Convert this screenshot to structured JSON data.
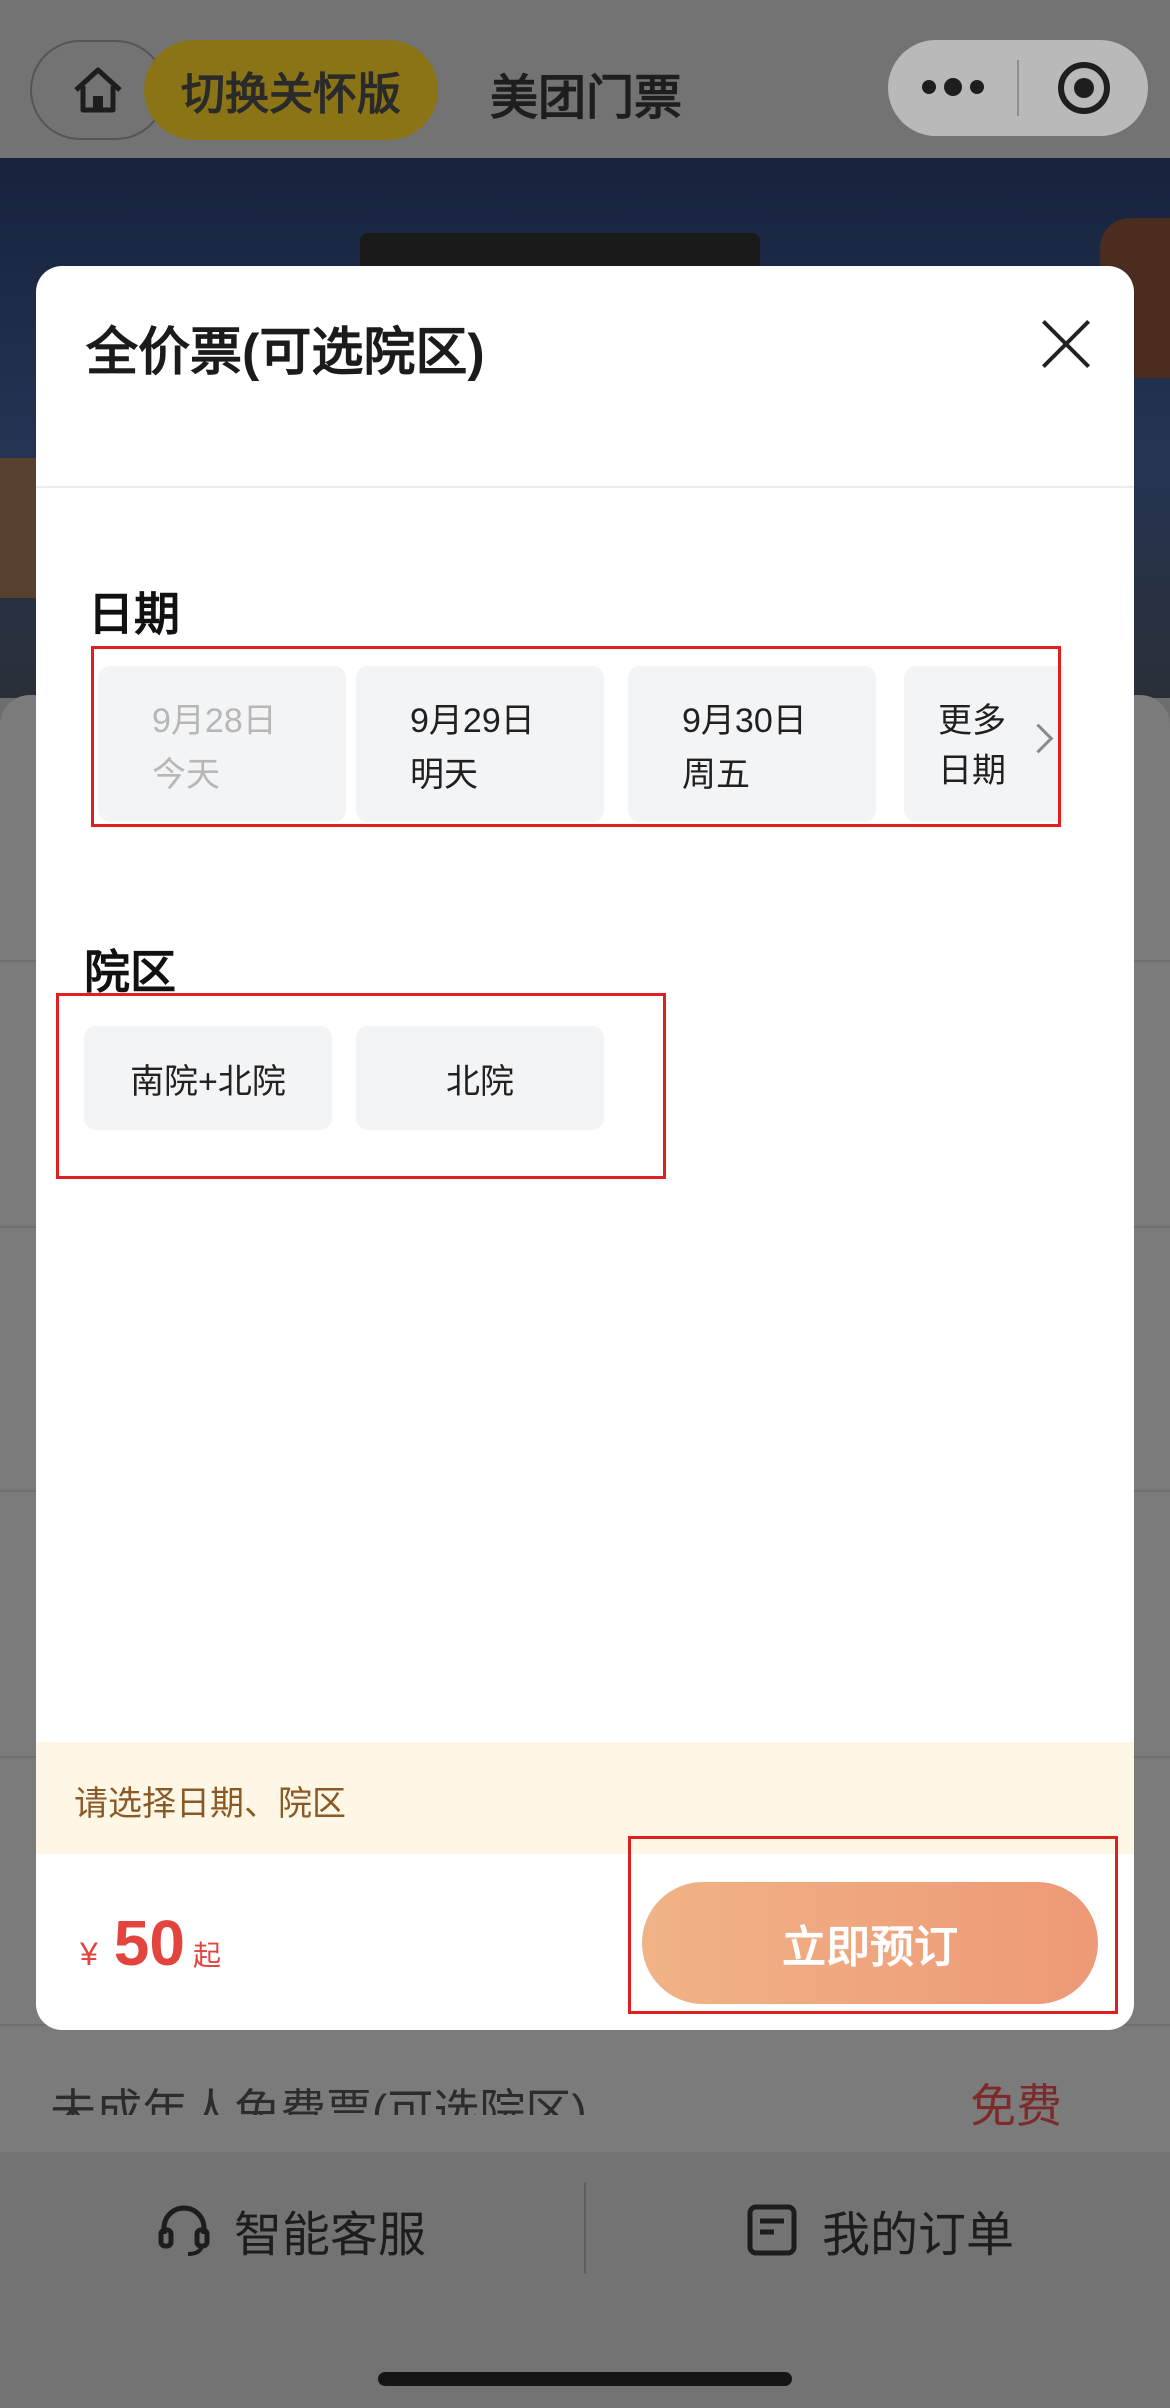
{
  "nav": {
    "care_mode_label": "切换关怀版",
    "title": "美团门票"
  },
  "modal": {
    "title": "全价票(可选院区)",
    "date_section_title": "日期",
    "dates": [
      {
        "date": "9月28日",
        "day": "今天"
      },
      {
        "date": "9月29日",
        "day": "明天"
      },
      {
        "date": "9月30日",
        "day": "周五"
      }
    ],
    "more_dates_line1": "更多",
    "more_dates_line2": "日期",
    "campus_section_title": "院区",
    "campuses": [
      "南院+北院",
      "北院"
    ],
    "hint": "请选择日期、院区",
    "price": {
      "currency": "¥",
      "amount": "50",
      "suffix": "起"
    },
    "book_label": "立即预订"
  },
  "background": {
    "ticket_label": "未成年人免费票(可选院区)",
    "ticket_price": "免费"
  },
  "bottom_bar": {
    "service_label": "智能客服",
    "orders_label": "我的订单"
  }
}
